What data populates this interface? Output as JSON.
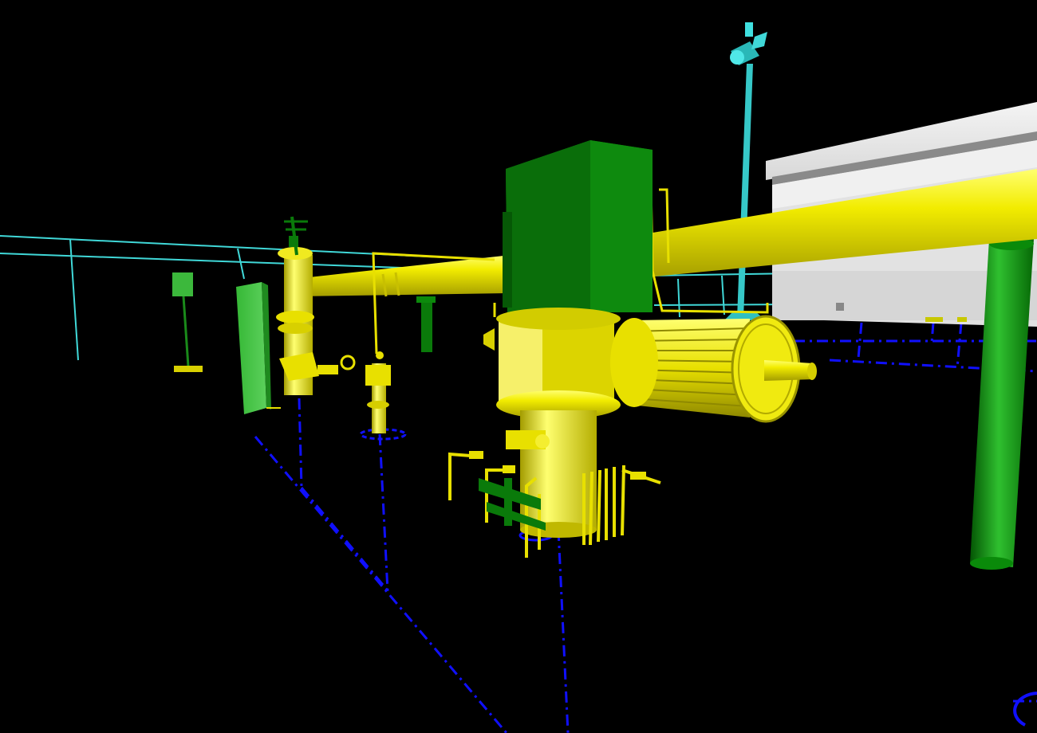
{
  "viewport": {
    "kind": "3D plant model view",
    "background": "#000000"
  },
  "colors": {
    "pipe_yellow": "#e8e000",
    "pipe_yellow_light": "#ffff60",
    "pipe_yellow_dark": "#9a9400",
    "equipment_green": "#0a7a0a",
    "equipment_green_light": "#2fb02f",
    "equipment_green_dark": "#045004",
    "instrument_cyan": "#40d8d8",
    "grid_blue": "#1010ff",
    "building_white": "#e6e6e6",
    "building_shadow": "#bdbdbd"
  },
  "objects": [
    {
      "name": "centerline-grid",
      "type": "dash-dot construction lines"
    },
    {
      "name": "handrail",
      "type": "cyan guard rail"
    },
    {
      "name": "lighting-pole",
      "type": "cyan mast with luminaire"
    },
    {
      "name": "building",
      "type": "white enclosure"
    },
    {
      "name": "main-header-pipe",
      "type": "large yellow pipe"
    },
    {
      "name": "vertical-pump",
      "type": "yellow pump casing"
    },
    {
      "name": "motor-enclosure",
      "type": "green box"
    },
    {
      "name": "heat-exchanger",
      "type": "finned cylinder"
    },
    {
      "name": "support-column",
      "type": "green column"
    },
    {
      "name": "control-valve",
      "type": "yellow valve assembly"
    },
    {
      "name": "local-panel",
      "type": "green panel"
    },
    {
      "name": "instrument-sign",
      "type": "green sign on post"
    },
    {
      "name": "drain-valves",
      "type": "small bore piping"
    }
  ]
}
